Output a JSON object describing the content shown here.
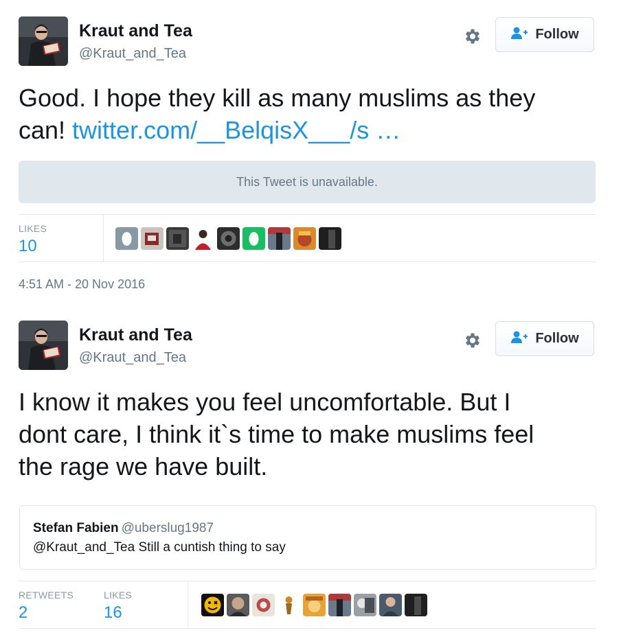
{
  "tweets": [
    {
      "author": {
        "name": "Kraut and Tea",
        "handle": "@Kraut_and_Tea"
      },
      "follow_label": "Follow",
      "text_line1": "Good. I hope they kill as many muslims as they",
      "text_line2_prefix": "can! ",
      "link": "twitter.com/__BelqisX___/s …",
      "unavailable_text": "This Tweet is unavailable.",
      "stats": {
        "likes_label": "LIKES",
        "likes_value": "10"
      },
      "timestamp": "4:51 AM - 20 Nov 2016"
    },
    {
      "author": {
        "name": "Kraut and Tea",
        "handle": "@Kraut_and_Tea"
      },
      "follow_label": "Follow",
      "text_line1": "I know it makes you feel uncomfortable. But I",
      "text_line2": "dont care, I think it`s time to make muslims feel",
      "text_line3": "the rage we have built.",
      "quote": {
        "name": "Stefan Fabien",
        "handle": "@uberslug1987",
        "text": "@Kraut_and_Tea Still a cuntish thing to say"
      },
      "stats": {
        "retweets_label": "RETWEETS",
        "retweets_value": "2",
        "likes_label": "LIKES",
        "likes_value": "16"
      }
    }
  ],
  "colors": {
    "link": "#1b95e0",
    "muted": "#657786",
    "border": "#e1e8ed",
    "unavailable_bg": "#e1e8ed"
  },
  "icons": {
    "settings": "gear-icon",
    "follow": "follow-person-plus-icon"
  }
}
